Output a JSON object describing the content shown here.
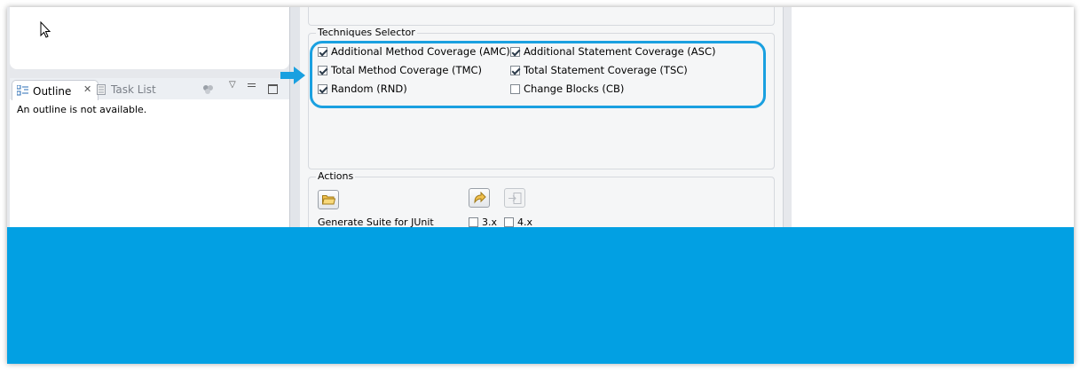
{
  "outline": {
    "tab_outline": "Outline",
    "tab_task_list": "Task List",
    "message": "An outline is not available."
  },
  "techniques": {
    "title": "Techniques Selector",
    "options": [
      {
        "label": "Additional Method Coverage (AMC)",
        "checked": true
      },
      {
        "label": "Additional Statement Coverage (ASC)",
        "checked": true
      },
      {
        "label": "Total Method Coverage (TMC)",
        "checked": true
      },
      {
        "label": "Total Statement Coverage (TSC)",
        "checked": true
      },
      {
        "label": "Random (RND)",
        "checked": true
      },
      {
        "label": "Change Blocks (CB)",
        "checked": false
      }
    ]
  },
  "actions": {
    "title": "Actions",
    "generate_label": "Generate Suite for JUnit",
    "junit3_label": "3.x",
    "junit4_label": "4.x"
  },
  "colors": {
    "highlight": "#1aa0e0",
    "banner": "#02a0e3"
  }
}
